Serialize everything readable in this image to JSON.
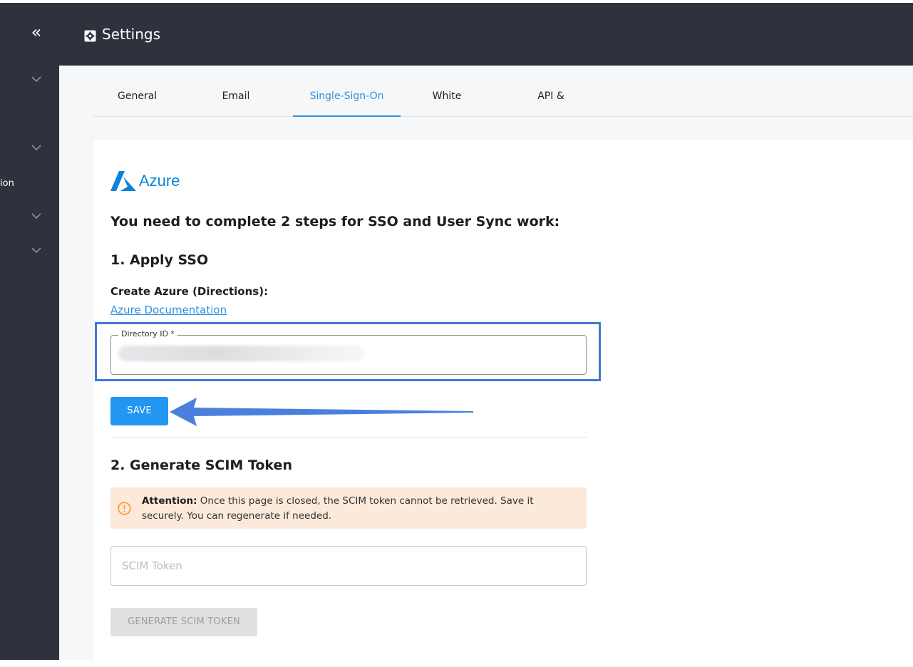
{
  "header": {
    "title": "Settings"
  },
  "sidebar": {
    "partial_label": "ion"
  },
  "tabs": [
    {
      "label": "General",
      "active": false
    },
    {
      "label": "Email Reminders",
      "active": false
    },
    {
      "label": "Single-Sign-On",
      "active": true
    },
    {
      "label": "White Label",
      "active": false
    },
    {
      "label": "API & Integration",
      "active": false
    }
  ],
  "sso": {
    "provider": "Azure",
    "intro": "You need to complete 2 steps for SSO and User Sync work:",
    "step1": {
      "heading": "1. Apply SSO",
      "create_label": "Create Azure (Directions):",
      "doc_link": "Azure Documentation",
      "directory_label": "Directory ID *",
      "save_label": "SAVE"
    },
    "step2": {
      "heading": "2. Generate SCIM Token",
      "alert_title": "Attention:",
      "alert_text": "Once this page is closed, the SCIM token cannot be retrieved. Save it securely. You can regenerate if needed.",
      "token_placeholder": "SCIM Token",
      "generate_label": "GENERATE SCIM TOKEN"
    }
  },
  "colors": {
    "accent": "#2196f3",
    "link": "#2d8fe0",
    "highlight": "#4178d4",
    "alert_bg": "#fde9d9",
    "alert_icon": "#f39c3c",
    "sidebar_bg": "#2e323d"
  }
}
